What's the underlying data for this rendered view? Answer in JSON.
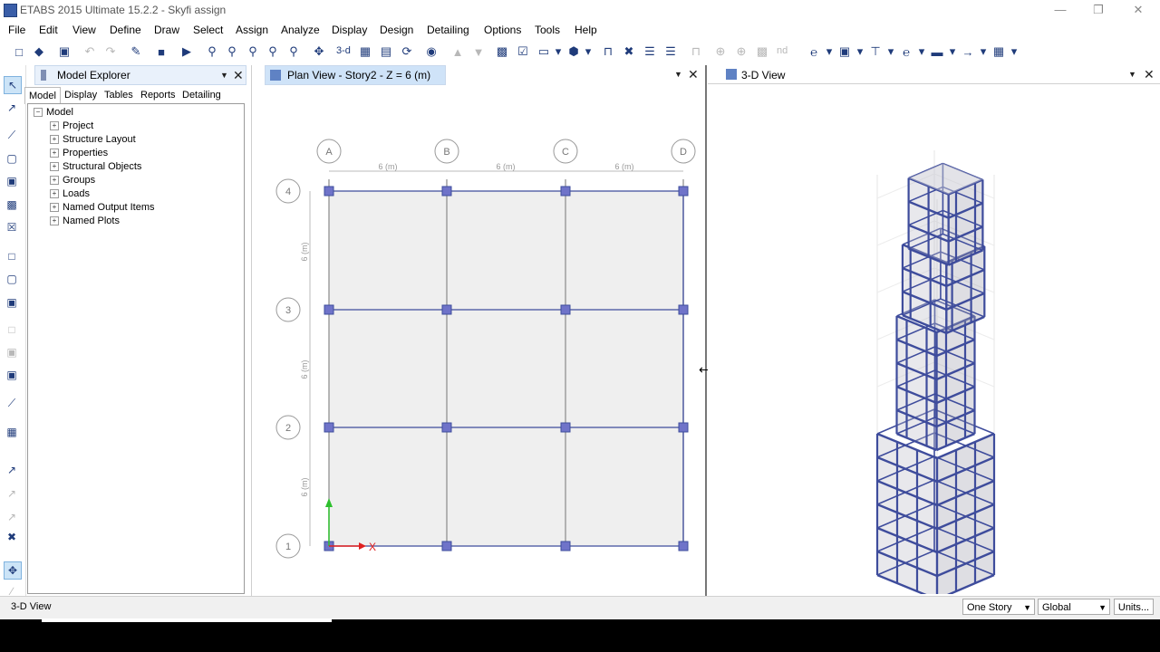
{
  "window": {
    "title": "ETABS 2015 Ultimate 15.2.2 - Skyfi assign"
  },
  "menu": [
    "File",
    "Edit",
    "View",
    "Define",
    "Draw",
    "Select",
    "Assign",
    "Analyze",
    "Display",
    "Design",
    "Detailing",
    "Options",
    "Tools",
    "Help"
  ],
  "toolbar": {
    "view3d_label": "3-d",
    "nd_label": "nd"
  },
  "explorer": {
    "title": "Model Explorer",
    "tabs": [
      "Model",
      "Display",
      "Tables",
      "Reports",
      "Detailing"
    ],
    "root": "Model",
    "items": [
      "Project",
      "Structure Layout",
      "Properties",
      "Structural Objects",
      "Groups",
      "Loads",
      "Named Output Items",
      "Named Plots"
    ]
  },
  "plan_view": {
    "title": "Plan View - Story2 - Z = 6 (m)",
    "grid_x": [
      "A",
      "B",
      "C",
      "D"
    ],
    "grid_y": [
      "4",
      "3",
      "2",
      "1"
    ],
    "spacing_label": "6 (m)",
    "axis_label": "X"
  },
  "view3d": {
    "title": "3-D View"
  },
  "status": {
    "left": "3-D View",
    "story_option": "One Story",
    "coord_option": "Global",
    "units_label": "Units..."
  },
  "colors": {
    "frame": "#3e4c9c",
    "node": "#6f73c9",
    "grid": "#8a8a8a",
    "slab": "#efefef"
  }
}
